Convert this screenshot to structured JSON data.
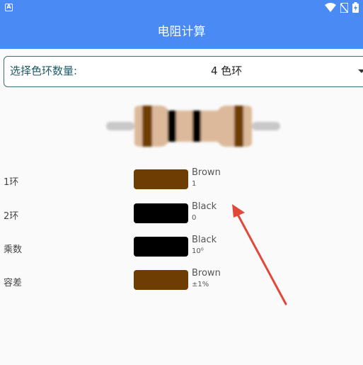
{
  "status_bar": {
    "app_icon_letter": "A"
  },
  "app_bar": {
    "title": "电阻计算"
  },
  "ring_select": {
    "label": "选择色环数量:",
    "selected_value": "4 色环"
  },
  "colors": {
    "brand": "#4a8af4",
    "brown": "#6e3d04",
    "black": "#000000",
    "resistor_body": "#dcb99a",
    "lead": "#c8c8c8",
    "annotation_arrow": "#e2483a"
  },
  "bands": [
    {
      "label": "1环",
      "color_name": "Brown",
      "value": "1",
      "swatch": "#6e3d04"
    },
    {
      "label": "2环",
      "color_name": "Black",
      "value": "0",
      "swatch": "#000000"
    },
    {
      "label": "乘数",
      "color_name": "Black",
      "value": "10⁰",
      "swatch": "#000000"
    },
    {
      "label": "容差",
      "color_name": "Brown",
      "value": "±1%",
      "swatch": "#6e3d04"
    }
  ]
}
